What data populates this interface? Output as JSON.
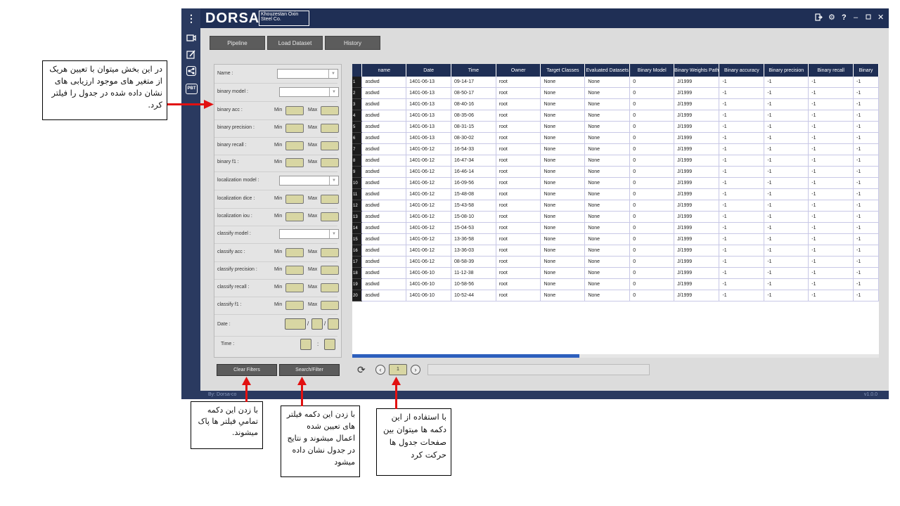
{
  "app": {
    "logo_main": "DORSA",
    "logo_sub": "Khouzestan Oxin Steel Co.",
    "footer_left": "By: Dorsa-co",
    "footer_right": "v1.0.0"
  },
  "side_icons": [
    "menu-dots-icon",
    "camera-icon",
    "edit-icon",
    "share-icon",
    "pbt-icon"
  ],
  "side_icon_labels": {
    "pbt": "PBT"
  },
  "tabs": [
    "Pipeline",
    "Load Dataset",
    "History"
  ],
  "filters": {
    "name": "Name  :",
    "binary_model": "binary model  :",
    "binary_acc": "binary acc  :",
    "binary_precision": "binary precision  :",
    "binary_recall": "binary recall  :",
    "binary_f1": "binary f1  :",
    "localization_model": "localization model  :",
    "localization_dice": "localization dice  :",
    "localization_iou": "localization iou  :",
    "classify_model": "classify model  :",
    "classify_acc": "classify acc  :",
    "classify_precision": "classify precision  :",
    "classify_recall": "classify recall  :",
    "classify_f1": "classify f1  :",
    "date": "Date  :",
    "time": "Time  :",
    "min": "Min",
    "max": "Max",
    "date_sep": "/",
    "time_sep": ":"
  },
  "buttons": {
    "clear": "Clear Filters",
    "search": "Search/Filter",
    "page": "1",
    "prev": "‹",
    "next": "›",
    "refresh": "⟳"
  },
  "table": {
    "headers": [
      "name",
      "Date",
      "Time",
      "Owner",
      "Target Classes",
      "Evaluated Datasets",
      "Binary Model",
      "Binary Weights Path",
      "Binary accuracy",
      "Binary precision",
      "Binary recall",
      "Binary"
    ],
    "rows": [
      [
        "1",
        "asdwd",
        "1401-06-13",
        "09-14-17",
        "root",
        "None",
        "None",
        "0",
        "J/1999",
        "-1",
        "-1",
        "-1",
        "-1"
      ],
      [
        "2",
        "asdwd",
        "1401-06-13",
        "08-50-17",
        "root",
        "None",
        "None",
        "0",
        "J/1999",
        "-1",
        "-1",
        "-1",
        "-1"
      ],
      [
        "3",
        "asdwd",
        "1401-06-13",
        "08-40-16",
        "root",
        "None",
        "None",
        "0",
        "J/1999",
        "-1",
        "-1",
        "-1",
        "-1"
      ],
      [
        "4",
        "asdwd",
        "1401-06-13",
        "08-35-06",
        "root",
        "None",
        "None",
        "0",
        "J/1999",
        "-1",
        "-1",
        "-1",
        "-1"
      ],
      [
        "5",
        "asdwd",
        "1401-06-13",
        "08-31-15",
        "root",
        "None",
        "None",
        "0",
        "J/1999",
        "-1",
        "-1",
        "-1",
        "-1"
      ],
      [
        "6",
        "asdwd",
        "1401-06-13",
        "08-30-02",
        "root",
        "None",
        "None",
        "0",
        "J/1999",
        "-1",
        "-1",
        "-1",
        "-1"
      ],
      [
        "7",
        "asdwd",
        "1401-06-12",
        "16-54-33",
        "root",
        "None",
        "None",
        "0",
        "J/1999",
        "-1",
        "-1",
        "-1",
        "-1"
      ],
      [
        "8",
        "asdwd",
        "1401-06-12",
        "16-47-34",
        "root",
        "None",
        "None",
        "0",
        "J/1999",
        "-1",
        "-1",
        "-1",
        "-1"
      ],
      [
        "9",
        "asdwd",
        "1401-06-12",
        "16-46-14",
        "root",
        "None",
        "None",
        "0",
        "J/1999",
        "-1",
        "-1",
        "-1",
        "-1"
      ],
      [
        "10",
        "asdwd",
        "1401-06-12",
        "16-09-56",
        "root",
        "None",
        "None",
        "0",
        "J/1999",
        "-1",
        "-1",
        "-1",
        "-1"
      ],
      [
        "11",
        "asdwd",
        "1401-06-12",
        "15-48-08",
        "root",
        "None",
        "None",
        "0",
        "J/1999",
        "-1",
        "-1",
        "-1",
        "-1"
      ],
      [
        "12",
        "asdwd",
        "1401-06-12",
        "15-43-58",
        "root",
        "None",
        "None",
        "0",
        "J/1999",
        "-1",
        "-1",
        "-1",
        "-1"
      ],
      [
        "13",
        "asdwd",
        "1401-06-12",
        "15-08-10",
        "root",
        "None",
        "None",
        "0",
        "J/1999",
        "-1",
        "-1",
        "-1",
        "-1"
      ],
      [
        "14",
        "asdwd",
        "1401-06-12",
        "15-04-53",
        "root",
        "None",
        "None",
        "0",
        "J/1999",
        "-1",
        "-1",
        "-1",
        "-1"
      ],
      [
        "15",
        "asdwd",
        "1401-06-12",
        "13-36-58",
        "root",
        "None",
        "None",
        "0",
        "J/1999",
        "-1",
        "-1",
        "-1",
        "-1"
      ],
      [
        "16",
        "asdwd",
        "1401-06-12",
        "13-36-03",
        "root",
        "None",
        "None",
        "0",
        "J/1999",
        "-1",
        "-1",
        "-1",
        "-1"
      ],
      [
        "17",
        "asdwd",
        "1401-06-12",
        "08-58-39",
        "root",
        "None",
        "None",
        "0",
        "J/1999",
        "-1",
        "-1",
        "-1",
        "-1"
      ],
      [
        "18",
        "asdwd",
        "1401-06-10",
        "11-12-38",
        "root",
        "None",
        "None",
        "0",
        "J/1999",
        "-1",
        "-1",
        "-1",
        "-1"
      ],
      [
        "19",
        "asdwd",
        "1401-06-10",
        "10-58-56",
        "root",
        "None",
        "None",
        "0",
        "J/1999",
        "-1",
        "-1",
        "-1",
        "-1"
      ],
      [
        "20",
        "asdwd",
        "1401-06-10",
        "10-52-44",
        "root",
        "None",
        "None",
        "0",
        "J/1999",
        "-1",
        "-1",
        "-1",
        "-1"
      ]
    ]
  },
  "annotations": {
    "filters_note": "در این بخش میتوان با تعیین هریک از متغیر های موجود ارزیابی های نشان داده شده در جدول را فیلتر کرد.",
    "clear_note": "با زدن این دکمه تمامیِ فیلتر ها پاک میشوند.",
    "search_note": "با زدن این دکمه فیلتر های تعیین شده اعمال میشوند و نتایج در جدول نشان داده میشود",
    "page_note": "با استفاده از این دکمه ها میتوان بین صفحات جدول ها حرکت کرد"
  },
  "colors": {
    "titlebar": "#1f2f55",
    "sidebar": "#2a3a60",
    "input_yellow": "#d8d6a3",
    "annotation_red": "#e21010",
    "scroll_thumb": "#2d5fbd"
  }
}
